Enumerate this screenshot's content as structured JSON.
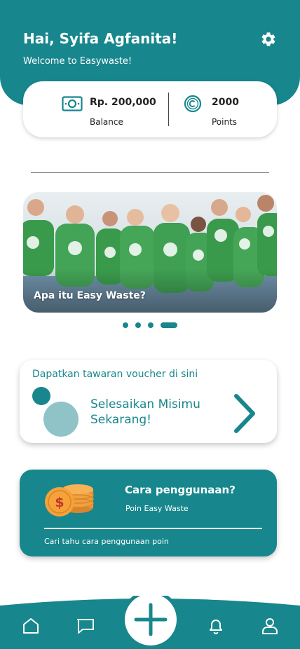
{
  "header": {
    "greeting": "Hai, Syifa Agfanita!",
    "welcome": "Welcome to Easywaste!"
  },
  "stats": {
    "balance_value": "Rp. 200,000",
    "balance_label": "Balance",
    "points_value": "2000",
    "points_label": "Points"
  },
  "banner": {
    "title": "Apa itu Easy Waste?"
  },
  "carousel": {
    "page_count": 4,
    "active_index": 3
  },
  "mission_card": {
    "heading": "Dapatkan tawaran voucher di sini",
    "line1": "Selesaikan Misimu",
    "line2": "Sekarang!"
  },
  "points_card": {
    "title": "Cara penggunaan?",
    "subtitle": "Poin Easy Waste",
    "link": "Cari tahu cara penggunaan poin"
  },
  "nav": {
    "items": [
      "home-icon",
      "chat-icon",
      "add-icon",
      "bell-icon",
      "profile-icon"
    ]
  },
  "colors": {
    "primary": "#17878d",
    "primary_light": "#8fc3c8",
    "coin": "#f5a23a"
  }
}
